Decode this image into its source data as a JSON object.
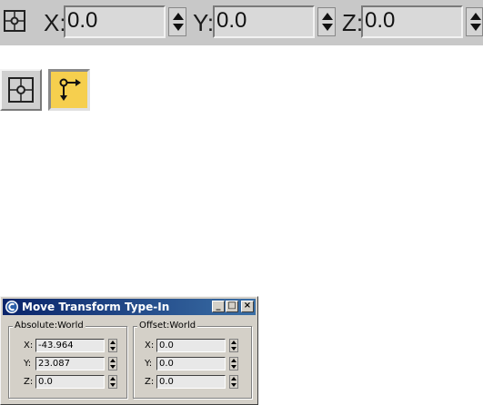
{
  "toolbar": {
    "mode_icon": "absolute-transform-icon",
    "fields": [
      {
        "axis": "X:",
        "value": "0.0"
      },
      {
        "axis": "Y:",
        "value": "0.0"
      },
      {
        "axis": "Z:",
        "value": "0.0"
      }
    ]
  },
  "mode_buttons": {
    "absolute": {
      "icon": "absolute-mode-icon",
      "state": "unpressed"
    },
    "offset": {
      "icon": "offset-mode-icon",
      "state": "pressed",
      "color": "#f6cf4e"
    }
  },
  "dialog": {
    "title": "Move Transform Type-In",
    "app_icon": "3dsmax-logo-icon",
    "title_buttons": {
      "minimize": "_",
      "maximize": "□",
      "close": "×"
    },
    "absolute_group": {
      "title": "Absolute:World",
      "rows": [
        {
          "axis": "X:",
          "value": "-43.964"
        },
        {
          "axis": "Y:",
          "value": "23.087"
        },
        {
          "axis": "Z:",
          "value": "0.0"
        }
      ]
    },
    "offset_group": {
      "title": "Offset:World",
      "rows": [
        {
          "axis": "X:",
          "value": "0.0"
        },
        {
          "axis": "Y:",
          "value": "0.0"
        },
        {
          "axis": "Z:",
          "value": "0.0"
        }
      ]
    }
  },
  "colors": {
    "toolbar_bg": "#c8c8c8",
    "dialog_bg": "#d4d0c8",
    "titlebar_start": "#0a246a",
    "titlebar_end": "#3a6ea5",
    "offset_active": "#f6cf4e"
  }
}
